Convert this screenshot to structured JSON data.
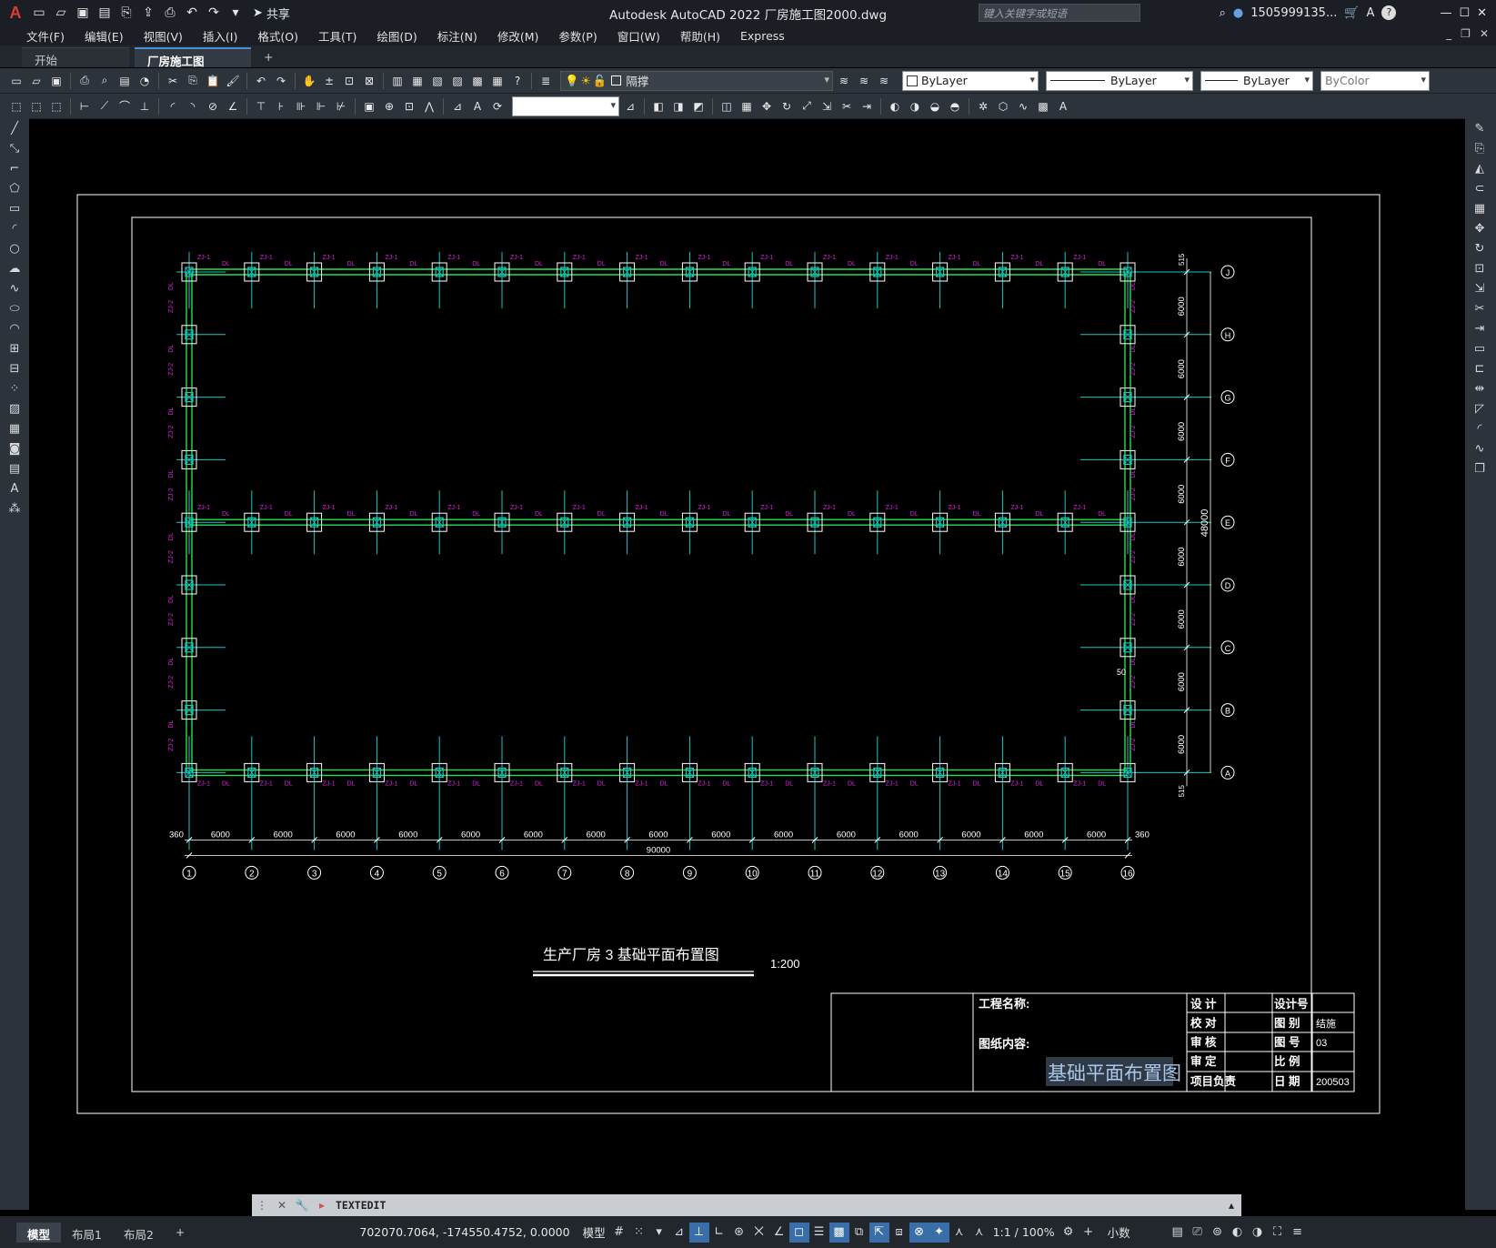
{
  "app": {
    "title": "Autodesk AutoCAD 2022    厂房施工图2000.dwg",
    "share_label": "共享",
    "search_placeholder": "键入关键字或短语",
    "user": "1505999135...",
    "logo": "A"
  },
  "menu": [
    "文件(F)",
    "编辑(E)",
    "视图(V)",
    "插入(I)",
    "格式(O)",
    "工具(T)",
    "绘图(D)",
    "标注(N)",
    "修改(M)",
    "参数(P)",
    "窗口(W)",
    "帮助(H)",
    "Express"
  ],
  "file_tabs": [
    {
      "label": "开始",
      "active": false
    },
    {
      "label": "厂房施工图2000*",
      "active": true
    }
  ],
  "toolbar": {
    "layer_name": "隔撑",
    "color": "ByLayer",
    "linetype": "ByLayer",
    "lineweight": "ByLayer",
    "plotstyle": "ByColor"
  },
  "drawing": {
    "title": "生产厂房 3 基础平面布置图",
    "scale": "1:200",
    "grid_numbers": [
      "1",
      "2",
      "3",
      "4",
      "5",
      "6",
      "7",
      "8",
      "9",
      "10",
      "11",
      "12",
      "13",
      "14",
      "15",
      "16"
    ],
    "grid_letters": [
      "J",
      "H",
      "G",
      "F",
      "E",
      "D",
      "C",
      "B",
      "A"
    ],
    "bay_dimension": "6000",
    "end_dimension": "360",
    "total_width": "90000",
    "total_height": "48000",
    "top_offset": "515",
    "bottom_offset": "515",
    "note_50": "50",
    "label_zj1": "ZJ-1",
    "label_zj2": "ZJ-2",
    "label_dl": "DL"
  },
  "titleblock": {
    "project_name_label": "工程名称:",
    "content_label": "图纸内容:",
    "content_value": "基础平面布置图",
    "rows": [
      {
        "k1": "设  计",
        "k2": "设计号",
        "v2": ""
      },
      {
        "k1": "校  对",
        "k2": "图  别",
        "v2": "结施"
      },
      {
        "k1": "审  核",
        "k2": "图  号",
        "v2": "03"
      },
      {
        "k1": "审  定",
        "k2": "比  例",
        "v2": ""
      },
      {
        "k1": "项目负责",
        "k2": "日  期",
        "v2": "200503"
      }
    ]
  },
  "command": {
    "text": "TEXTEDIT"
  },
  "status": {
    "layout_tabs": [
      {
        "label": "模型",
        "active": true
      },
      {
        "label": "布局1",
        "active": false
      },
      {
        "label": "布局2",
        "active": false
      }
    ],
    "add_tab": "+",
    "coordinates": "702070.7064, -174550.4752, 0.0000",
    "space": "模型",
    "annotation_scale": "1:1 / 100%",
    "units": "小数"
  }
}
